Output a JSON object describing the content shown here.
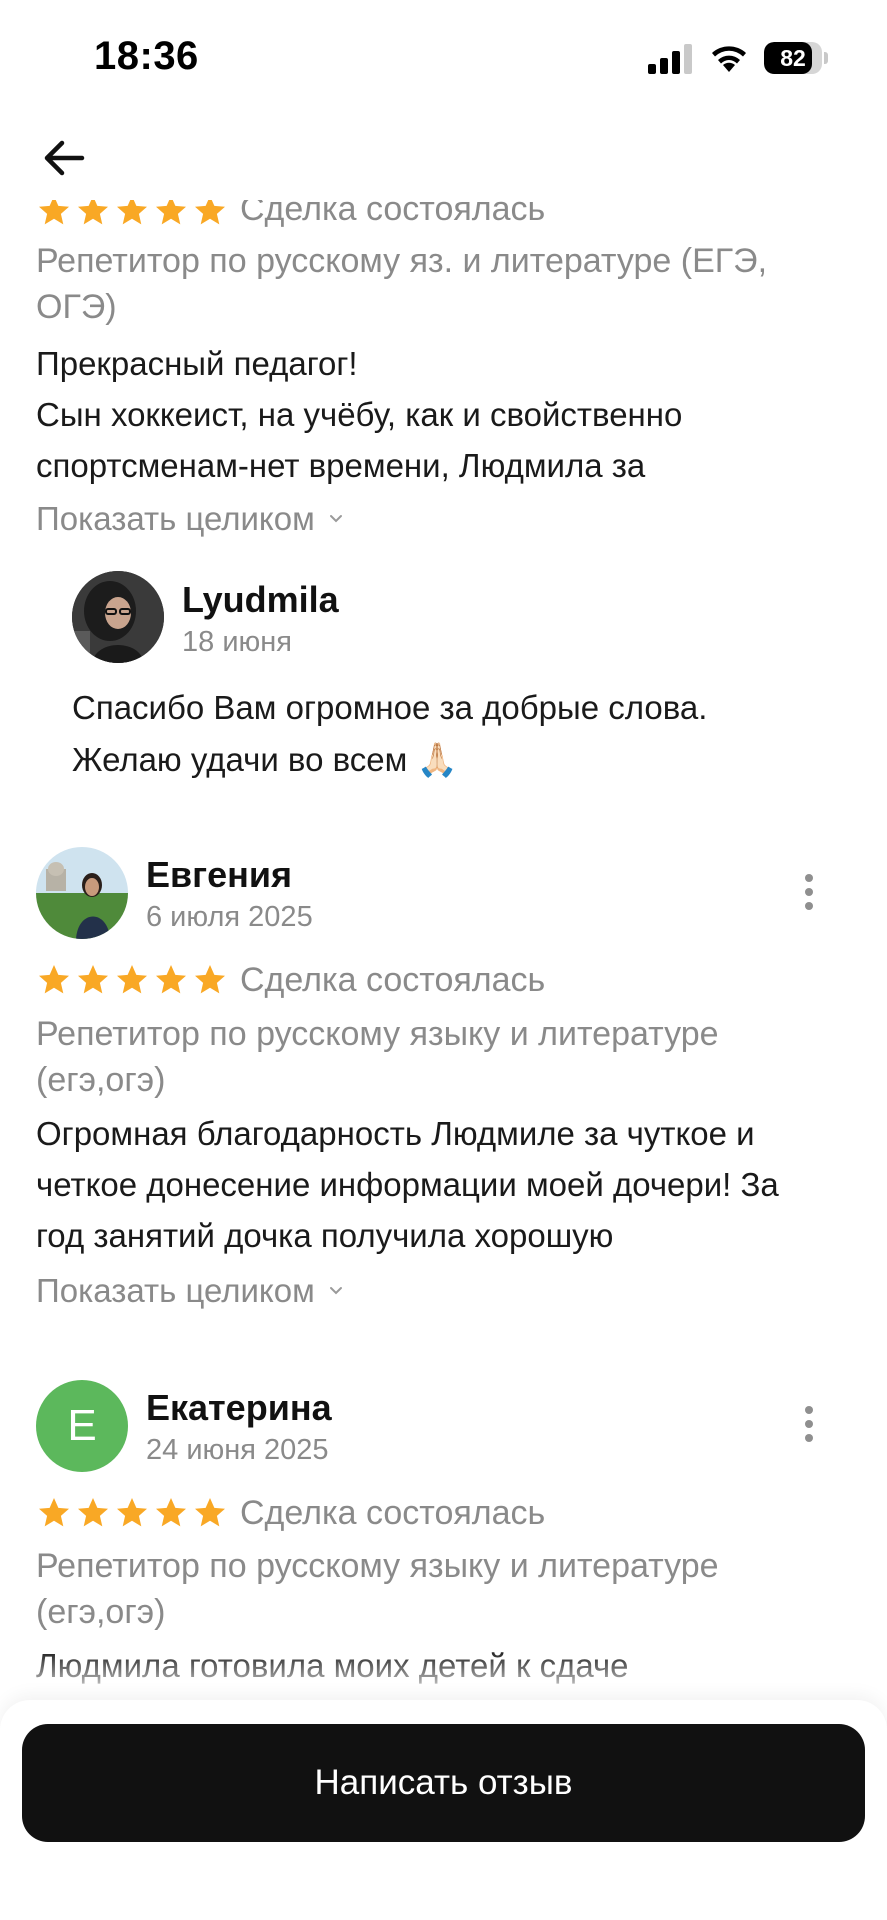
{
  "status_bar": {
    "time": "18:36",
    "battery": "82",
    "battery_level": 0.82
  },
  "nav": {
    "back_icon": "arrow-left-icon"
  },
  "reviews": [
    {
      "rating": 5,
      "deal_status": "Сделка состоялась",
      "service": "Репетитор по русскому яз. и литературе (ЕГЭ, ОГЭ)",
      "text_lines": [
        "Прекрасный педагог!",
        "Сын хоккеист, на учёбу, как и свойственно",
        "спортсменам-нет времени, Людмила за"
      ],
      "show_more": "Показать целиком",
      "reply": {
        "author": "Lyudmila",
        "date": "18 июня",
        "text_lines": [
          "Спасибо Вам огромное за добрые слова.",
          "Желаю удачи во всем 🙏🏻"
        ]
      }
    },
    {
      "author": "Евгения",
      "date": "6 июля 2025",
      "rating": 5,
      "deal_status": "Сделка состоялась",
      "service": "Репетитор по русскому языку и литературе (егэ,огэ)",
      "text_lines": [
        "Огромная благодарность Людмиле за чуткое и",
        "четкое донесение информации моей дочери! За",
        "год занятий дочка получила хорошую"
      ],
      "show_more": "Показать целиком"
    },
    {
      "author": "Екатерина",
      "author_initial": "Е",
      "date": "24 июня 2025",
      "rating": 5,
      "deal_status": "Сделка состоялась",
      "service": "Репетитор по русскому языку и литературе (егэ,огэ)",
      "text_lines": [
        "Людмила готовила моих детей к сдаче"
      ]
    }
  ],
  "bottom": {
    "write_review_label": "Написать отзыв"
  },
  "colors": {
    "star": "#f9a825",
    "muted": "#8a8a8a",
    "button_bg": "#111111",
    "letter_avatar": "#5cb85c"
  }
}
